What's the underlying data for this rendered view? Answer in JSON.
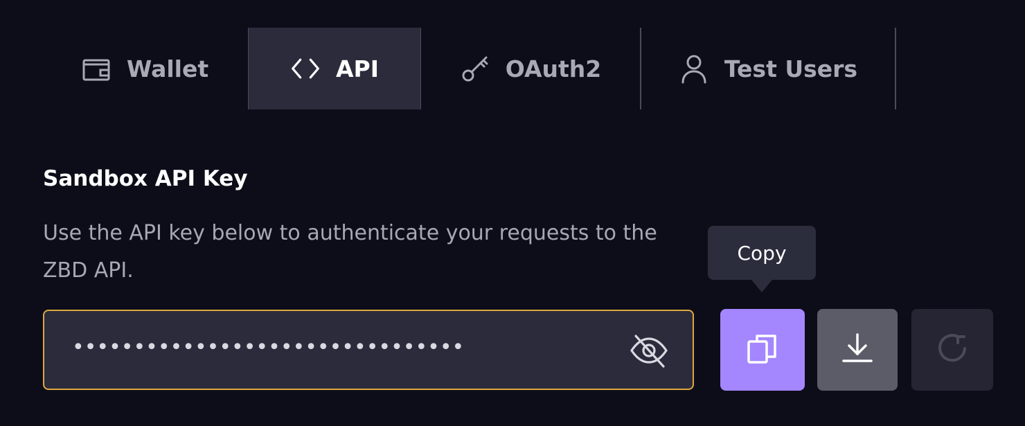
{
  "tabs": [
    {
      "label": "Wallet",
      "icon": "wallet-icon",
      "active": false
    },
    {
      "label": "API",
      "icon": "code-icon",
      "active": true
    },
    {
      "label": "OAuth2",
      "icon": "key-icon",
      "active": false
    },
    {
      "label": "Test Users",
      "icon": "user-icon",
      "active": false
    }
  ],
  "api_key_section": {
    "title": "Sandbox API Key",
    "description": "Use the API key below to authenticate your requests to the ZBD API.",
    "masked_value": "••••••••••••••••••••••••••••••••",
    "visibility_icon": "eye-off-icon"
  },
  "actions": {
    "copy_tooltip": "Copy",
    "copy_icon": "copy-icon",
    "download_icon": "download-icon",
    "regenerate_icon": "refresh-icon"
  },
  "colors": {
    "background": "#0d0d1a",
    "active_tab": "#2b2b3c",
    "input_border": "#e0a83f",
    "copy_button": "#a486ff",
    "download_button": "#5c5c68",
    "regenerate_button": "#252533"
  }
}
